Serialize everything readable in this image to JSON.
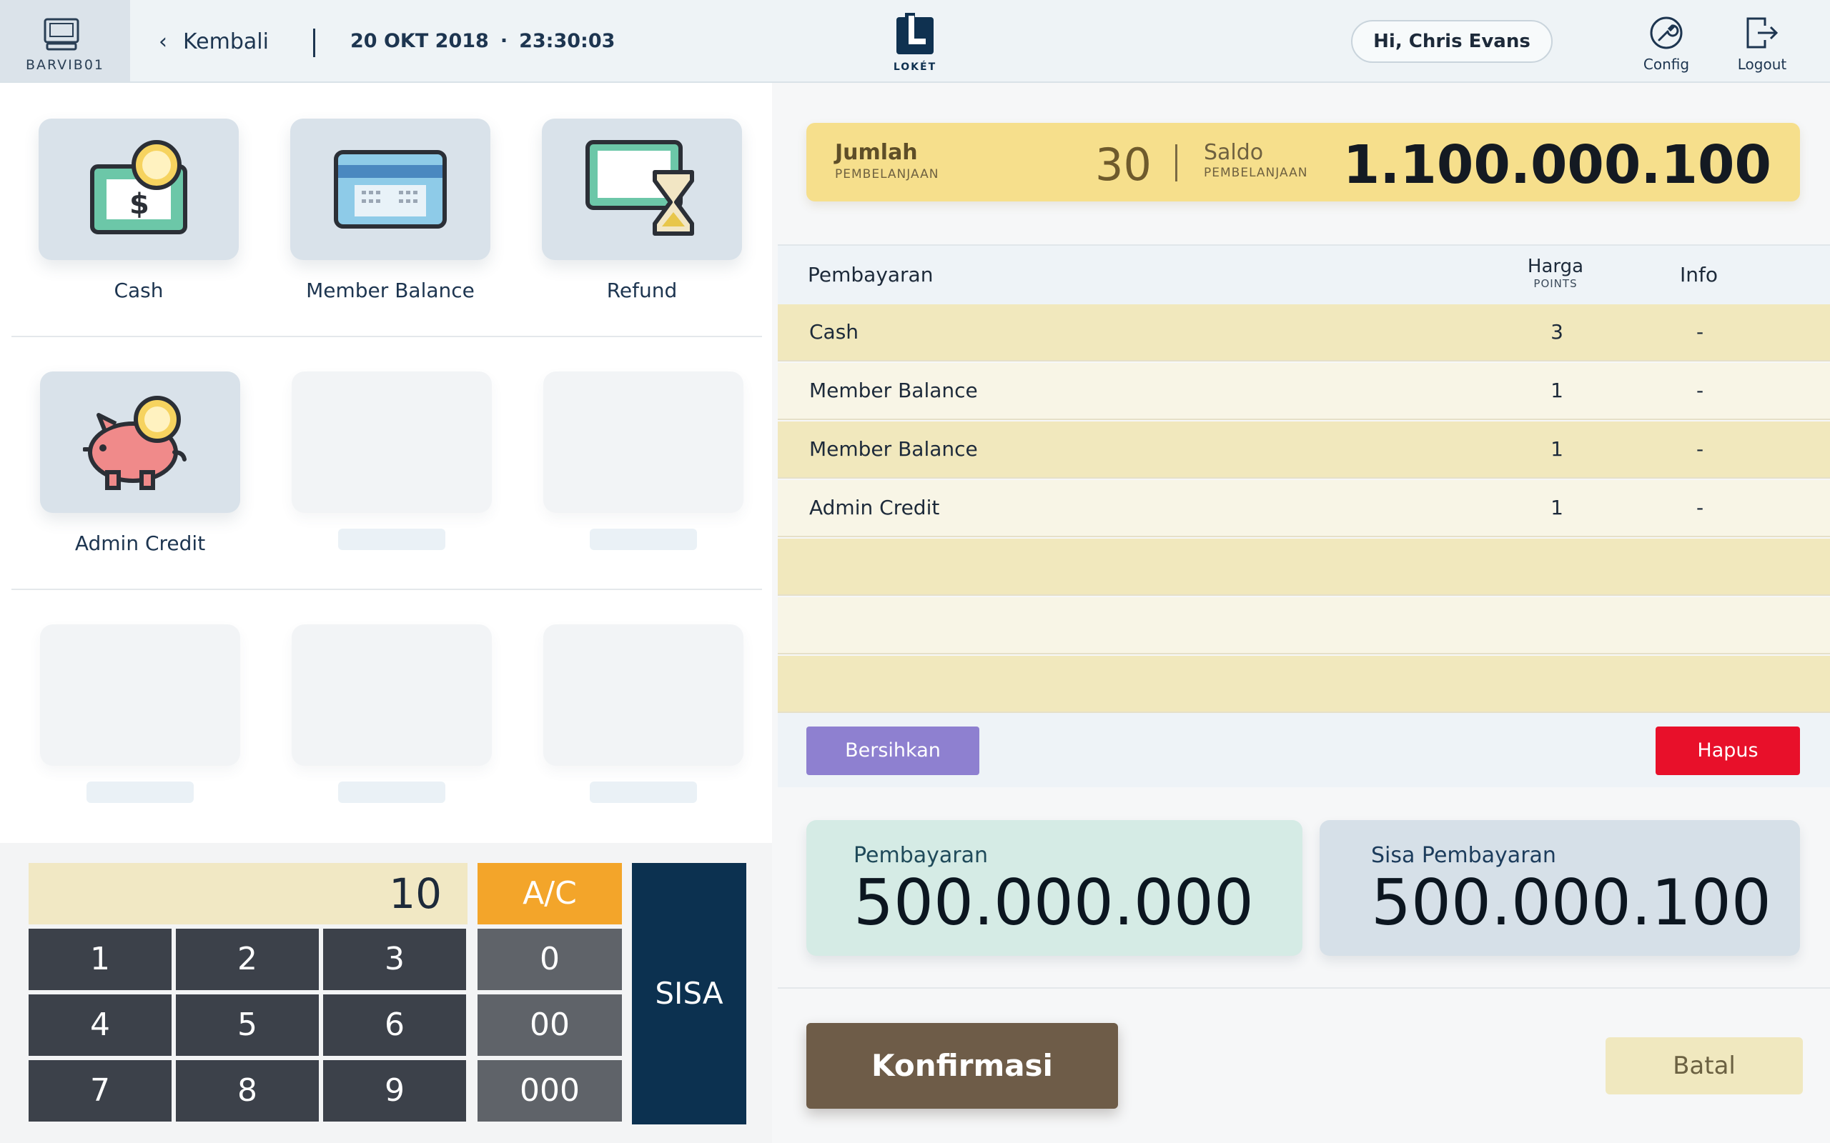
{
  "header": {
    "station_label": "BARVIB01",
    "back_label": "Kembali",
    "date": "20 OKT 2018",
    "separator": "·",
    "time": "23:30:03",
    "logo_label": "LOKÉT",
    "greeting": "Hi, Chris Evans",
    "config_label": "Config",
    "logout_label": "Logout"
  },
  "payment_methods": [
    {
      "label": "Cash",
      "icon": "cash-icon"
    },
    {
      "label": "Member Balance",
      "icon": "card-icon"
    },
    {
      "label": "Refund",
      "icon": "refund-icon"
    },
    {
      "label": "Admin Credit",
      "icon": "piggy-bank-icon"
    }
  ],
  "keypad": {
    "display_value": "10",
    "ac_label": "A/C",
    "sisa_label": "SISA",
    "keys": [
      "1",
      "2",
      "3",
      "4",
      "5",
      "6",
      "7",
      "8",
      "9"
    ],
    "zero_keys": [
      "0",
      "00",
      "000"
    ]
  },
  "summary": {
    "jumlah_label": "Jumlah",
    "jumlah_sub": "PEMBELANJAAN",
    "count": "30",
    "saldo_label": "Saldo",
    "saldo_sub": "PEMBELANJAAN",
    "saldo_value": "1.100.000.100"
  },
  "table": {
    "col_payment": "Pembayaran",
    "col_price": "Harga",
    "col_price_sub": "POINTS",
    "col_info": "Info",
    "rows": [
      {
        "name": "Cash",
        "price": "3",
        "info": "-"
      },
      {
        "name": "Member Balance",
        "price": "1",
        "info": "-"
      },
      {
        "name": "Member Balance",
        "price": "1",
        "info": "-"
      },
      {
        "name": "Admin Credit",
        "price": "1",
        "info": "-"
      }
    ]
  },
  "actions": {
    "clear_label": "Bersihkan",
    "delete_label": "Hapus",
    "confirm_label": "Konfirmasi",
    "cancel_label": "Batal"
  },
  "totals": {
    "payment_label": "Pembayaran",
    "payment_value": "500.000.000",
    "remaining_label": "Sisa Pembayaran",
    "remaining_value": "500.000.100"
  },
  "colors": {
    "accent_navy": "#0c3150",
    "ac_orange": "#f3a52a",
    "delete_red": "#e8102a",
    "clear_purple": "#8e80d0",
    "confirm_brown": "#6e5c48",
    "summary_yellow": "#f6df8c"
  }
}
